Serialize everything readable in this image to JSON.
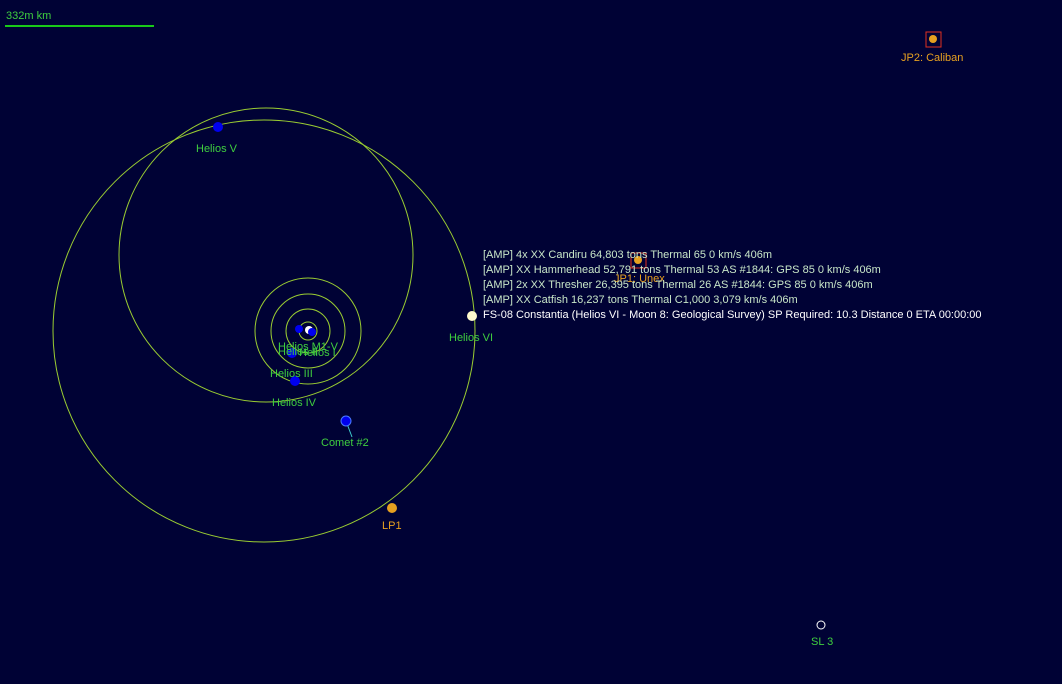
{
  "scale": {
    "label": "332m km"
  },
  "colors": {
    "background": "#000235",
    "orbit": "#9acd32",
    "planet": "#0000ee",
    "label_green": "#3fcf3f",
    "jump_point": "#e6a020",
    "fleet": "#fffacd"
  },
  "bodies": {
    "helios_v": "Helios V",
    "helios_vi": "Helios VI",
    "helios_m1v": "Helios M1-V",
    "helios_i": "Helios I",
    "helios_ii": "Helios II",
    "helios_iii": "Helios III",
    "helios_iv": "Helios IV",
    "comet_2": "Comet #2",
    "sl3": "SL 3"
  },
  "jump_points": {
    "jp1": "JP1: Unex",
    "jp2": "JP2: Caliban",
    "lp1": "LP1"
  },
  "contacts": [
    "[AMP]  4x XX Candiru  64,803 tons   Thermal 65   0 km/s  406m",
    "[AMP]  XX Hammerhead  52,791 tons   Thermal 53   AS #1844: GPS 85   0 km/s  406m",
    "[AMP]  2x XX Thresher  26,395 tons   Thermal 26   AS #1844: GPS 85   0 km/s  406m",
    "[AMP]  XX Catfish  16,237 tons   Thermal C1,000   3,079 km/s  406m"
  ],
  "fleet": {
    "label": "FS-08 Constantia  (Helios VI - Moon 8: Geological Survey)  SP Required: 10.3   Distance 0   ETA 00:00:00"
  }
}
